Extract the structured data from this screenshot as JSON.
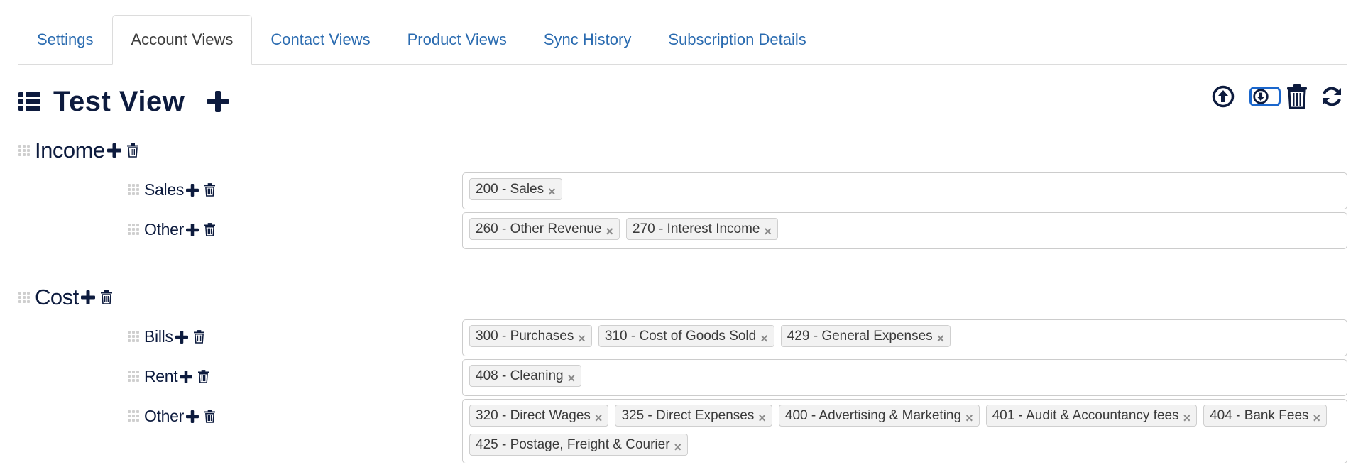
{
  "tabs": [
    {
      "label": "Settings",
      "active": false
    },
    {
      "label": "Account Views",
      "active": true
    },
    {
      "label": "Contact Views",
      "active": false
    },
    {
      "label": "Product Views",
      "active": false
    },
    {
      "label": "Sync History",
      "active": false
    },
    {
      "label": "Subscription Details",
      "active": false
    }
  ],
  "view": {
    "title": "Test View",
    "icon": "list-icon",
    "add_icon": "plus-icon"
  },
  "actions": [
    {
      "name": "upload",
      "icon": "arrow-circle-up-icon"
    },
    {
      "name": "download",
      "icon": "arrow-circle-down-icon",
      "focused": true
    },
    {
      "name": "delete",
      "icon": "trash-icon"
    },
    {
      "name": "refresh",
      "icon": "refresh-icon"
    }
  ],
  "colors": {
    "primary_text": "#0d1b3e",
    "tab_link": "#2a6bb0",
    "focus_ring": "#1a66cc",
    "tag_bg": "#f2f2f2",
    "tag_border": "#cfcfcf",
    "drag_handle": "#cfcfcf"
  },
  "groups": [
    {
      "name": "Income",
      "subgroups": [
        {
          "name": "Sales",
          "tags": [
            "200 - Sales"
          ]
        },
        {
          "name": "Other",
          "tags": [
            "260 - Other Revenue",
            "270 - Interest Income"
          ]
        }
      ]
    },
    {
      "name": "Cost",
      "subgroups": [
        {
          "name": "Bills",
          "tags": [
            "300 - Purchases",
            "310 - Cost of Goods Sold",
            "429 - General Expenses"
          ]
        },
        {
          "name": "Rent",
          "tags": [
            "408 - Cleaning"
          ]
        },
        {
          "name": "Other",
          "tags": [
            "320 - Direct Wages",
            "325 - Direct Expenses",
            "400 - Advertising & Marketing",
            "401 - Audit & Accountancy fees",
            "404 - Bank Fees",
            "425 - Postage, Freight & Courier"
          ]
        }
      ]
    }
  ],
  "tag_remove_glyph": "×"
}
